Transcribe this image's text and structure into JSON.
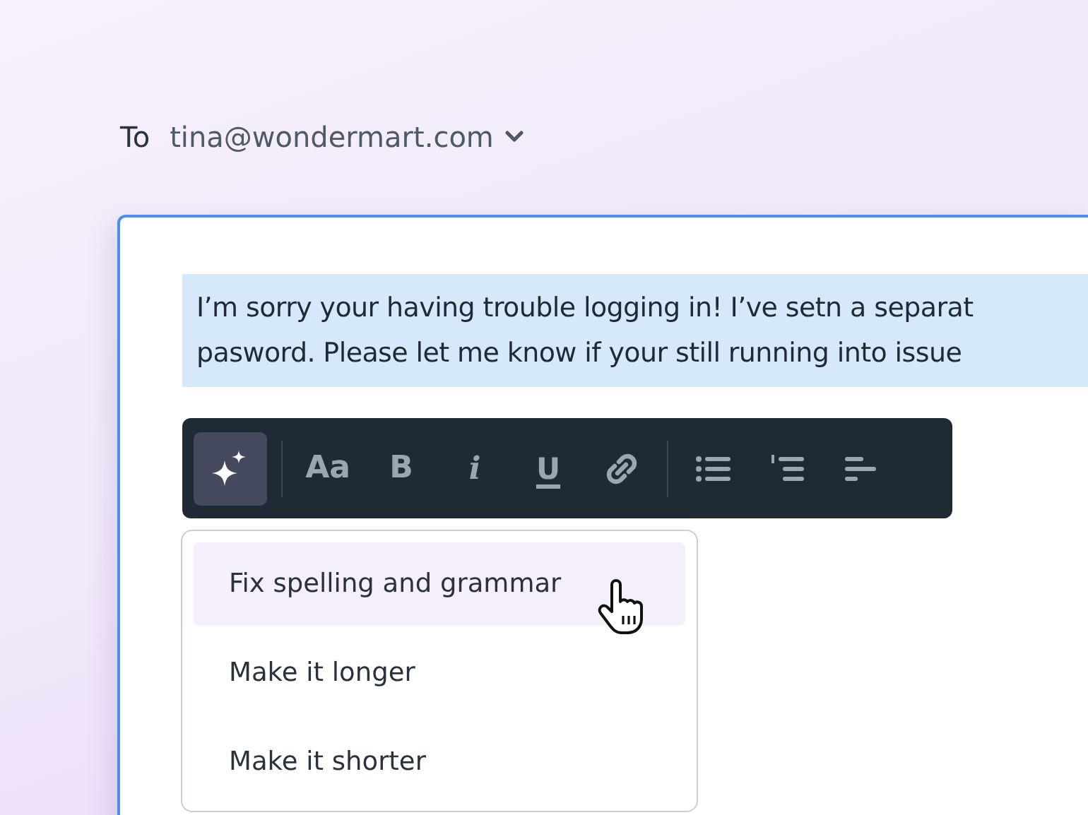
{
  "recipient": {
    "label": "To",
    "address": "tina@wondermart.com"
  },
  "message": {
    "lines": [
      "I’m sorry your having trouble logging in! I’ve setn a separat",
      "pasword. Please let me know if your still running into issue"
    ],
    "selected": true
  },
  "toolbar": {
    "groups": [
      {
        "buttons": [
          {
            "kind": "sparkle",
            "selected": true
          }
        ]
      },
      {
        "buttons": [
          {
            "kind": "font",
            "label": "Aa",
            "selected": false
          },
          {
            "kind": "bold",
            "label": "B",
            "selected": false
          },
          {
            "kind": "italic",
            "label": "i",
            "selected": false
          },
          {
            "kind": "underline",
            "label": "U",
            "selected": false
          },
          {
            "kind": "link",
            "selected": false
          }
        ]
      },
      {
        "buttons": [
          {
            "kind": "bullet-list",
            "selected": false
          },
          {
            "kind": "numbered-list",
            "selected": false
          },
          {
            "kind": "align",
            "selected": false
          }
        ]
      }
    ]
  },
  "menu": {
    "items": [
      {
        "label": "Fix spelling and grammar",
        "selected": true
      },
      {
        "label": "Make it longer",
        "selected": false
      },
      {
        "label": "Make it shorter",
        "selected": false
      }
    ]
  }
}
